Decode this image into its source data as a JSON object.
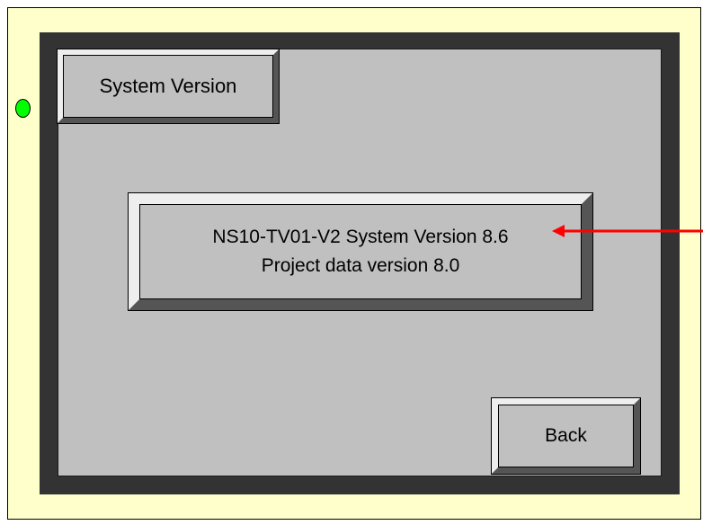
{
  "screen": {
    "title_label": "System Version",
    "version_line_1": "NS10-TV01-V2 System Version 8.6",
    "version_line_2": "Project data version 8.0",
    "back_label": "Back"
  },
  "colors": {
    "slide_background": "#ffffcc",
    "bezel": "#333333",
    "screen_face": "#c0c0c0",
    "status_led": "#00ff00",
    "annotation_arrow": "#ff0000"
  },
  "icons": {
    "status_indicator": "green-led-icon",
    "callout": "red-arrow-icon"
  }
}
